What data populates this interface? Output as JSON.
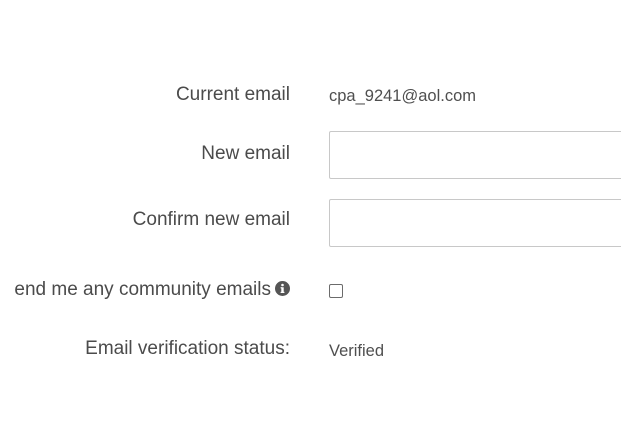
{
  "form": {
    "current_email": {
      "label": "Current email",
      "value": "cpa_9241@aol.com"
    },
    "new_email": {
      "label": "New email",
      "value": "",
      "placeholder": ""
    },
    "confirm_email": {
      "label": "Confirm new email",
      "value": "",
      "placeholder": ""
    },
    "community_emails": {
      "label": "end me any community emails",
      "checked": false,
      "info_icon": "info-circle-icon"
    },
    "verification": {
      "label": "Email verification status:",
      "value": "Verified"
    }
  }
}
